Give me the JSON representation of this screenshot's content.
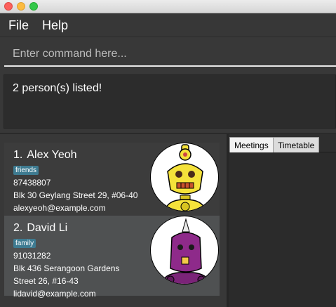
{
  "menu": {
    "file": "File",
    "help": "Help"
  },
  "command": {
    "placeholder": "Enter command here..."
  },
  "result": {
    "text": "2 person(s) listed!"
  },
  "persons": [
    {
      "index": "1.",
      "name": "Alex Yeoh",
      "tag": "friends",
      "phone": "87438807",
      "address_lines": [
        "Blk 30 Geylang Street 29, #06-40"
      ],
      "email": "alexyeoh@example.com"
    },
    {
      "index": "2.",
      "name": "David Li",
      "tag": "family",
      "phone": "91031282",
      "address_lines": [
        "Blk 436 Serangoon Gardens",
        "Street 26, #16-43"
      ],
      "email": "lidavid@example.com"
    }
  ],
  "tabs": [
    {
      "label": "Meetings"
    },
    {
      "label": "Timetable"
    }
  ],
  "colors": {
    "tag_bg": "#3e7b91",
    "card_selected": "#4f5152"
  }
}
